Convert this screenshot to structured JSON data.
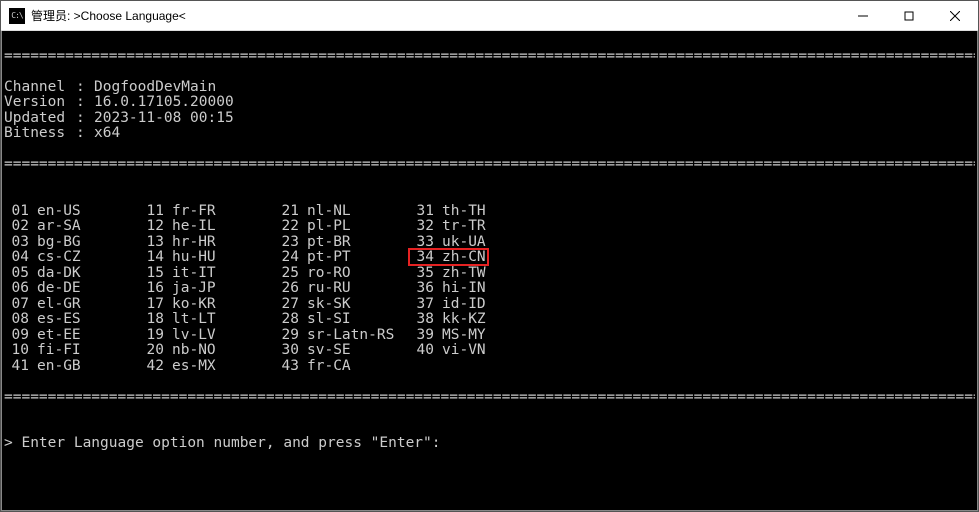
{
  "titlebar": {
    "icon_text": "C:\\",
    "title": "管理员: >Choose Language<"
  },
  "divider": "=================================================================================================================",
  "header": {
    "rows": [
      {
        "key": "Channel",
        "sep": ":",
        "value": "DogfoodDevMain"
      },
      {
        "key": "Version",
        "sep": ":",
        "value": "16.0.17105.20000"
      },
      {
        "key": "Updated",
        "sep": ":",
        "value": "2023-11-08 00:15"
      },
      {
        "key": "Bitness",
        "sep": ":",
        "value": "x64"
      }
    ]
  },
  "languages": {
    "rows": [
      [
        {
          "n": "01",
          "c": "en-US"
        },
        {
          "n": "11",
          "c": "fr-FR"
        },
        {
          "n": "21",
          "c": "nl-NL"
        },
        {
          "n": "31",
          "c": "th-TH"
        }
      ],
      [
        {
          "n": "02",
          "c": "ar-SA"
        },
        {
          "n": "12",
          "c": "he-IL"
        },
        {
          "n": "22",
          "c": "pl-PL"
        },
        {
          "n": "32",
          "c": "tr-TR"
        }
      ],
      [
        {
          "n": "03",
          "c": "bg-BG"
        },
        {
          "n": "13",
          "c": "hr-HR"
        },
        {
          "n": "23",
          "c": "pt-BR"
        },
        {
          "n": "33",
          "c": "uk-UA"
        }
      ],
      [
        {
          "n": "04",
          "c": "cs-CZ"
        },
        {
          "n": "14",
          "c": "hu-HU"
        },
        {
          "n": "24",
          "c": "pt-PT"
        },
        {
          "n": "34",
          "c": "zh-CN"
        }
      ],
      [
        {
          "n": "05",
          "c": "da-DK"
        },
        {
          "n": "15",
          "c": "it-IT"
        },
        {
          "n": "25",
          "c": "ro-RO"
        },
        {
          "n": "35",
          "c": "zh-TW"
        }
      ],
      [
        {
          "n": "06",
          "c": "de-DE"
        },
        {
          "n": "16",
          "c": "ja-JP"
        },
        {
          "n": "26",
          "c": "ru-RU"
        },
        {
          "n": "36",
          "c": "hi-IN"
        }
      ],
      [
        {
          "n": "07",
          "c": "el-GR"
        },
        {
          "n": "17",
          "c": "ko-KR"
        },
        {
          "n": "27",
          "c": "sk-SK"
        },
        {
          "n": "37",
          "c": "id-ID"
        }
      ],
      [
        {
          "n": "08",
          "c": "es-ES"
        },
        {
          "n": "18",
          "c": "lt-LT"
        },
        {
          "n": "28",
          "c": "sl-SI"
        },
        {
          "n": "38",
          "c": "kk-KZ"
        }
      ],
      [
        {
          "n": "09",
          "c": "et-EE"
        },
        {
          "n": "19",
          "c": "lv-LV"
        },
        {
          "n": "29",
          "c": "sr-Latn-RS"
        },
        {
          "n": "39",
          "c": "MS-MY"
        }
      ],
      [
        {
          "n": "10",
          "c": "fi-FI"
        },
        {
          "n": "20",
          "c": "nb-NO"
        },
        {
          "n": "30",
          "c": "sv-SE"
        },
        {
          "n": "40",
          "c": "vi-VN"
        }
      ],
      [
        {
          "n": "41",
          "c": "en-GB"
        },
        {
          "n": "42",
          "c": "es-MX"
        },
        {
          "n": "43",
          "c": "fr-CA"
        }
      ]
    ]
  },
  "highlight": {
    "row": 3,
    "col": 3
  },
  "prompt": "> Enter Language option number, and press \"Enter\":"
}
